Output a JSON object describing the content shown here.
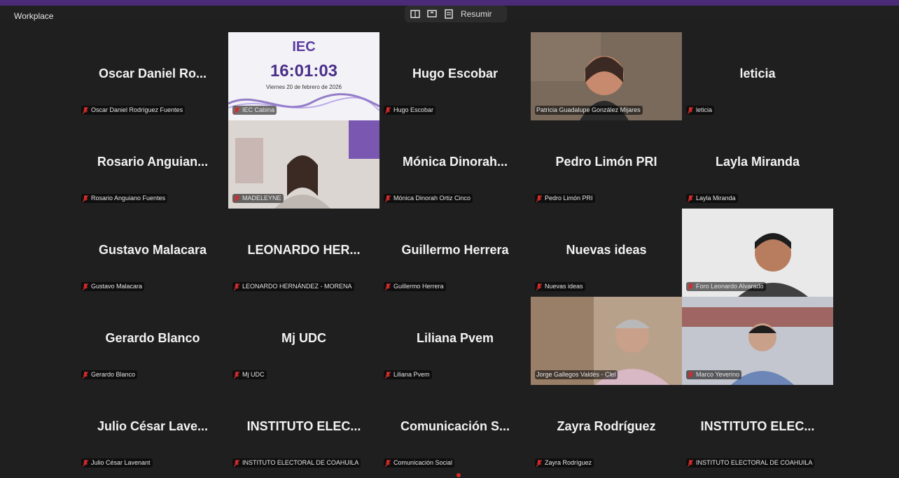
{
  "app": {
    "title": "Workplace",
    "toolbar": {
      "summarize_label": "Resumir"
    }
  },
  "colors": {
    "topbar": "#4b2a78",
    "tile_bg": "#1f1f1f",
    "active_speaker": "#3fd07a",
    "mic_muted": "#d62b2b"
  },
  "clock_card": {
    "logo_text": "IEC",
    "time": "16:01:03",
    "date": "Viernes 20 de febrero de 2026"
  },
  "participants": [
    {
      "display": "Oscar Daniel Ro...",
      "full": "Oscar Daniel Rodríguez Fuentes",
      "video": false
    },
    {
      "display": "",
      "full": "IEC Cabina",
      "video": "clock"
    },
    {
      "display": "Hugo Escobar",
      "full": "Hugo Escobar",
      "video": false
    },
    {
      "display": "",
      "full": "Patricia Guadalupe González Mijares",
      "video": "active"
    },
    {
      "display": "leticia",
      "full": "leticia",
      "video": false
    },
    {
      "display": "Rosario  Anguian...",
      "full": "Rosario Anguiano Fuentes",
      "video": false
    },
    {
      "display": "",
      "full": "MADELEYNE",
      "video": "cam"
    },
    {
      "display": "Mónica  Dinorah...",
      "full": "Mónica Dinorah Ortiz Cinco",
      "video": false
    },
    {
      "display": "Pedro Limón PRI",
      "full": "Pedro Limón PRI",
      "video": false
    },
    {
      "display": "Layla Miranda",
      "full": "Layla Miranda",
      "video": false
    },
    {
      "display": "Gustavo Malacara",
      "full": "Gustavo Malacara",
      "video": false
    },
    {
      "display": "LEONARDO  HER...",
      "full": "LEONARDO HERNÁNDEZ - MORENA",
      "video": false
    },
    {
      "display": "Guillermo Herrera",
      "full": "Guillermo Herrera",
      "video": false
    },
    {
      "display": "Nuevas ideas",
      "full": "Nuevas ideas",
      "video": false
    },
    {
      "display": "",
      "full": "Foro Leonardo Alvarado",
      "video": "cam"
    },
    {
      "display": "Gerardo Blanco",
      "full": "Gerardo Blanco",
      "video": false
    },
    {
      "display": "Mj UDC",
      "full": "Mj UDC",
      "video": false
    },
    {
      "display": "Liliana Pvem",
      "full": "Liliana Pvem",
      "video": false
    },
    {
      "display": "",
      "full": "Jorge Gallegos Valdés - Clel",
      "video": "cam"
    },
    {
      "display": "",
      "full": "Marco Yeverino",
      "video": "cam"
    },
    {
      "display": "Julio César Lave...",
      "full": "Julio César Lavenant",
      "video": false
    },
    {
      "display": "INSTITUTO  ELEC...",
      "full": "INSTITUTO ELECTORAL DE COAHUILA",
      "video": false
    },
    {
      "display": "Comunicación  S...",
      "full": "Comunicación Social",
      "video": false
    },
    {
      "display": "Zayra Rodríguez",
      "full": "Zayra Rodríguez",
      "video": false
    },
    {
      "display": "INSTITUTO  ELEC...",
      "full": "INSTITUTO ELECTORAL DE COAHUILA",
      "video": false
    }
  ]
}
